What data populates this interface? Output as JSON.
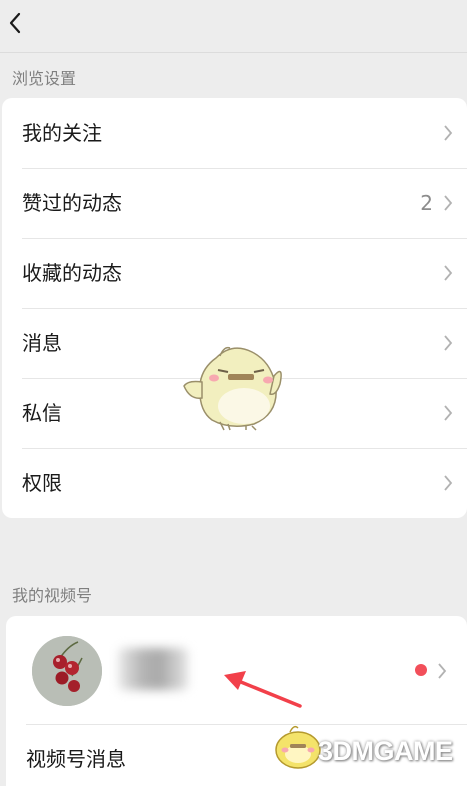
{
  "browse_settings": {
    "title": "浏览设置",
    "items": [
      {
        "label": "我的关注"
      },
      {
        "label": "赞过的动态",
        "count": "2"
      },
      {
        "label": "收藏的动态"
      },
      {
        "label": "消息"
      },
      {
        "label": "私信"
      },
      {
        "label": "权限"
      }
    ]
  },
  "my_channels": {
    "title": "我的视频号",
    "messages_label": "视频号消息"
  },
  "icons": {
    "back": "chevron-left-icon",
    "row_arrow": "chevron-right-icon",
    "unread_dot_color": "#f24f5a"
  },
  "watermark": {
    "text": "3DMGAME"
  }
}
